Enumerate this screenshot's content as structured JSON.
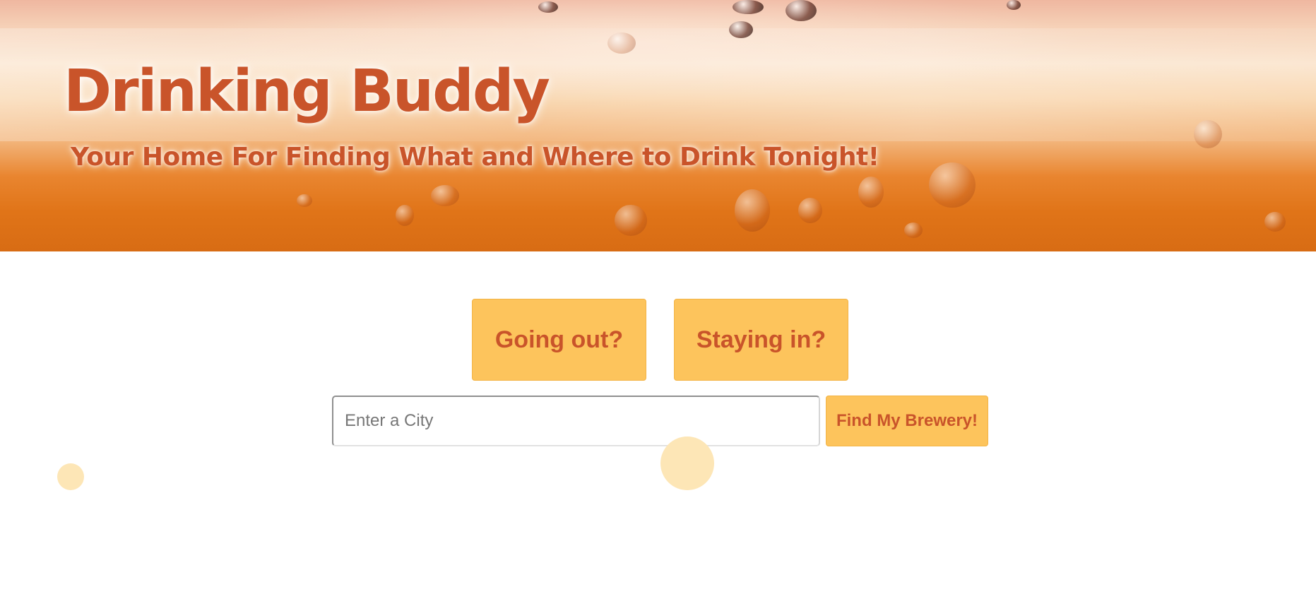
{
  "header": {
    "title": "Drinking Buddy",
    "subtitle": "Your Home For Finding What and Where to Drink Tonight!"
  },
  "choices": {
    "going_out_label": "Going out?",
    "staying_in_label": "Staying in?"
  },
  "search": {
    "value": "",
    "placeholder": "Enter a City",
    "submit_label": "Find My Brewery!"
  },
  "colors": {
    "accent": "#fdc45c",
    "brand_text": "#c9542a",
    "bubble": "#fde6b6"
  }
}
